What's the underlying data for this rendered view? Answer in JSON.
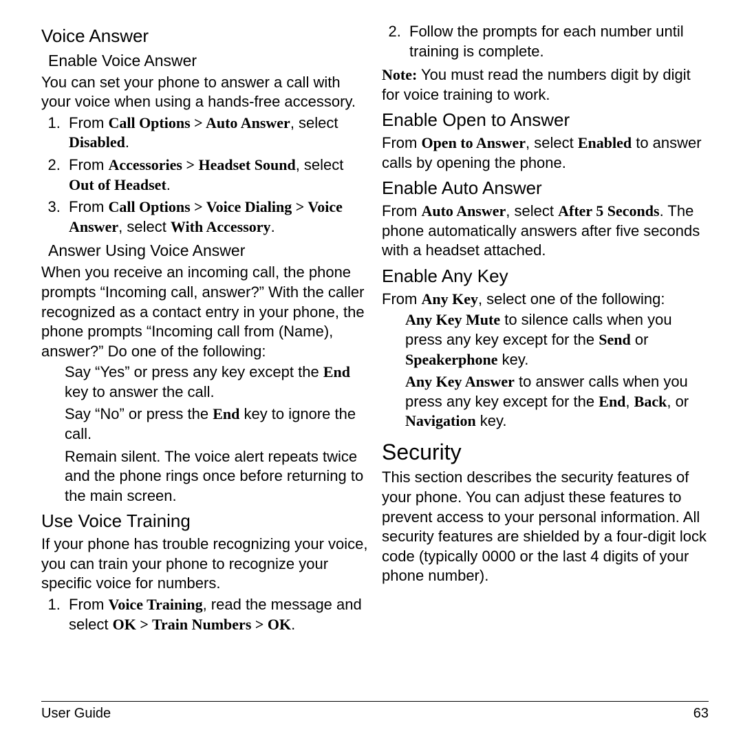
{
  "col1": {
    "voiceAnswerHeading": "Voice Answer",
    "enableVAHeading": "Enable Voice Answer",
    "enableVAIntro": "You can set your phone to answer a call with your voice when using a hands-free accessory.",
    "step1_pre": "From ",
    "step1_b1": "Call Options > Auto Answer",
    "step1_mid": ", select ",
    "step1_b2": "Disabled",
    "step1_end": ".",
    "step2_pre": "From ",
    "step2_b1": "Accessories > Headset Sound",
    "step2_mid": ", select ",
    "step2_b2": "Out of Headset",
    "step2_end": ".",
    "step3_pre": "From ",
    "step3_b1": "Call Options > Voice Dialing > Voice Answer",
    "step3_mid": ", select ",
    "step3_b2": "With Accessory",
    "step3_end": ".",
    "answerUsingVAHeading": "Answer Using Voice Answer",
    "answerUsingVAIntro": "When you receive an incoming call, the phone prompts “Incoming call, answer?” With the caller recognized as a contact entry in your phone, the phone prompts “Incoming call from (Name), answer?” Do one of the following:",
    "bul1_pre": "Say “Yes” or press any key except the ",
    "bul1_b": "End",
    "bul1_post": " key to answer the call.",
    "bul2_pre": "Say “No” or press the ",
    "bul2_b": "End",
    "bul2_post": " key to ignore the call.",
    "bul3": "Remain silent. The voice alert repeats twice and the phone rings once before returning to the main screen.",
    "useVTHeading": "Use Voice Training",
    "useVTIntro": "If your phone has trouble recognizing your voice, you can train your phone to recognize your specific voice for numbers.",
    "vt1_pre": "From ",
    "vt1_b1": "Voice Training",
    "vt1_mid": ", read the message and select ",
    "vt1_b2": "OK > Train Numbers > OK",
    "vt1_end": "."
  },
  "col2": {
    "vt2": "Follow the prompts for each number until training is complete.",
    "noteLabel": "Note:",
    "noteText": " You must read the numbers digit by digit for voice training to work.",
    "openHeading": "Enable Open to Answer",
    "open_pre": "From ",
    "open_b1": "Open to Answer",
    "open_mid": ", select ",
    "open_b2": "Enabled",
    "open_post": " to answer calls by opening the phone.",
    "autoHeading": "Enable Auto Answer",
    "auto_pre": "From ",
    "auto_b1": "Auto Answer",
    "auto_mid": ", select ",
    "auto_b2": "After 5 Seconds",
    "auto_post": ". The phone automatically answers after five seconds with a headset attached.",
    "anyKeyHeading": "Enable Any Key",
    "anyKey_pre": "From ",
    "anyKey_b": "Any Key",
    "anyKey_post": ", select one of the following:",
    "ak1_b1": "Any Key Mute",
    "ak1_mid": " to silence calls when you press any key except for the ",
    "ak1_b2": "Send",
    "ak1_or": " or ",
    "ak1_b3": "Speakerphone",
    "ak1_end": " key.",
    "ak2_b1": "Any Key Answer",
    "ak2_mid": " to answer calls when you press any key except for the ",
    "ak2_b2": "End",
    "ak2_c1": ", ",
    "ak2_b3": "Back",
    "ak2_c2": ", or ",
    "ak2_b4": "Navigation",
    "ak2_end": " key.",
    "securityHeading": "Security",
    "securityText": "This section describes the security features of your phone. You can adjust these features to prevent access to your personal information. All security features are shielded by a four-digit lock code (typically 0000 or the last 4 digits of your phone number)."
  },
  "footer": {
    "left": "User Guide",
    "right": "63"
  }
}
